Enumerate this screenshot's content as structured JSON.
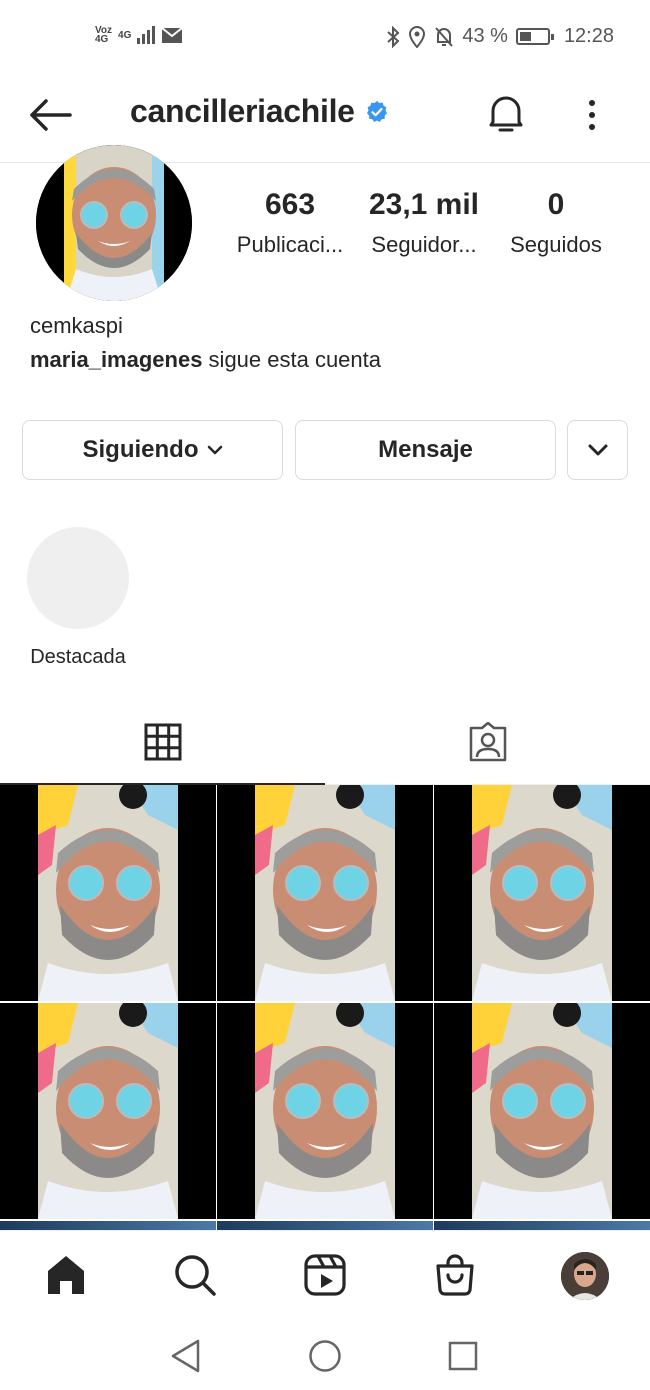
{
  "status_bar": {
    "carrier_top": "Voz",
    "carrier_bottom": "4G",
    "net_top": "4G",
    "battery_text": "43 %",
    "battery_level": 0.43,
    "time": "12:28"
  },
  "header": {
    "username": "cancilleriachile",
    "verified": true
  },
  "profile": {
    "stats": [
      {
        "value": "663",
        "label": "Publicaci..."
      },
      {
        "value": "23,1 mil",
        "label": "Seguidor..."
      },
      {
        "value": "0",
        "label": "Seguidos"
      }
    ],
    "bio_name": "cemkaspi",
    "followed_by_user": "maria_imagenes",
    "followed_by_text": " sigue esta cuenta"
  },
  "buttons": {
    "following": "Siguiendo",
    "message": "Mensaje"
  },
  "highlights": [
    {
      "label": "Destacada"
    }
  ],
  "tabs": [
    {
      "icon": "grid-icon",
      "active": true
    },
    {
      "icon": "tagged-icon",
      "active": false
    }
  ],
  "posts_count_visible": 6,
  "bottom_nav": [
    "home-icon",
    "search-icon",
    "reels-icon",
    "shop-icon",
    "profile-avatar"
  ],
  "colors": {
    "verified": "#3897f0",
    "text": "#262626",
    "border": "#dbdbdb",
    "highlight_bg": "#efefef"
  }
}
